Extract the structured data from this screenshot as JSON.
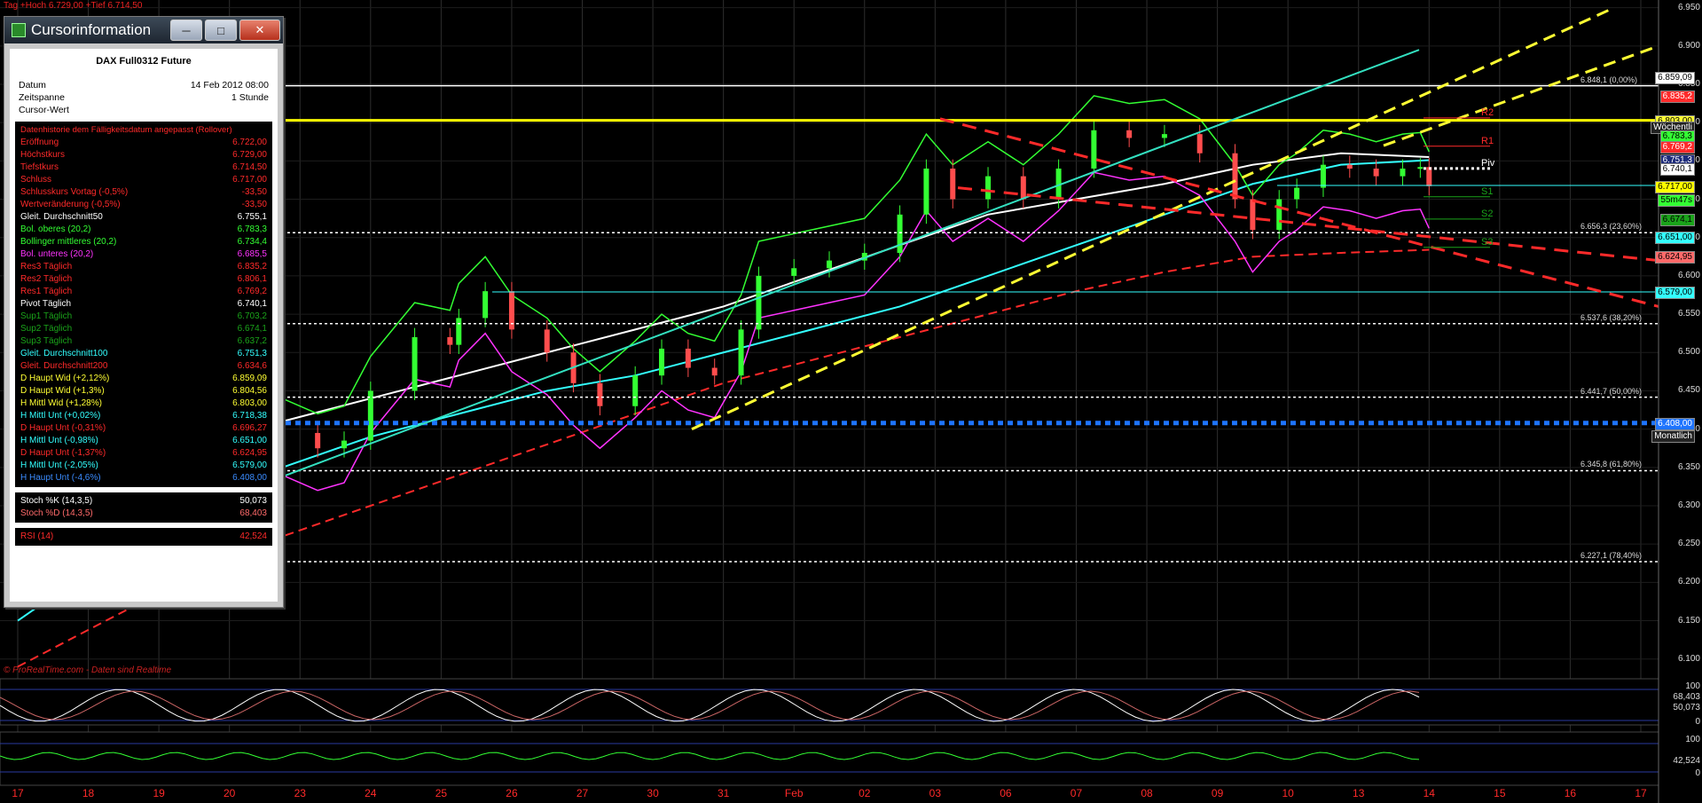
{
  "top_label": "Tag +Hoch 6.729,00 +Tief 6.714,50",
  "watermark": "© ProRealTime.com - Daten sind Realtime",
  "info_window": {
    "title": "Cursorinformation",
    "buttons": [
      "minimize",
      "maximize",
      "close"
    ],
    "instrument": "DAX Full0312 Future",
    "header_rows": [
      {
        "label": "Datum",
        "value": "14 Feb 2012 08:00"
      },
      {
        "label": "Zeitspanne",
        "value": "1 Stunde"
      },
      {
        "label": "Cursor-Wert",
        "value": ""
      }
    ],
    "history_title": "Datenhistorie dem Fälligkeitsdatum angepasst (Rollover)",
    "rows": [
      {
        "label": "Eröffnung",
        "value": "6.722,00",
        "color": "#ff2a2a"
      },
      {
        "label": "Höchstkurs",
        "value": "6.729,00",
        "color": "#ff2a2a"
      },
      {
        "label": "Tiefstkurs",
        "value": "6.714,50",
        "color": "#ff2a2a"
      },
      {
        "label": "Schluss",
        "value": "6.717,00",
        "color": "#ff2a2a"
      },
      {
        "label": "Schlusskurs Vortag (-0,5%)",
        "value": "-33,50",
        "color": "#ff2a2a"
      },
      {
        "label": "Wertveränderung (-0,5%)",
        "value": "-33,50",
        "color": "#ff2a2a"
      },
      {
        "label": "Gleit. Durchschnitt50",
        "value": "6.755,1",
        "color": "#ffffff"
      },
      {
        "label": "Bol. oberes (20,2)",
        "value": "6.783,3",
        "color": "#33ff33"
      },
      {
        "label": "Bollinger mittleres (20,2)",
        "value": "6.734,4",
        "color": "#33ff33"
      },
      {
        "label": "Bol. unteres (20,2)",
        "value": "6.685,5",
        "color": "#ff33ff"
      },
      {
        "label": "Res3 Täglich",
        "value": "6.835,2",
        "color": "#ff2a2a"
      },
      {
        "label": "Res2 Täglich",
        "value": "6.806,1",
        "color": "#ff2a2a"
      },
      {
        "label": "Res1 Täglich",
        "value": "6.769,2",
        "color": "#ff2a2a"
      },
      {
        "label": "Pivot Täglich",
        "value": "6.740,1",
        "color": "#ffffff"
      },
      {
        "label": "Sup1 Täglich",
        "value": "6.703,2",
        "color": "#1aa31a"
      },
      {
        "label": "Sup2 Täglich",
        "value": "6.674,1",
        "color": "#1aa31a"
      },
      {
        "label": "Sup3 Täglich",
        "value": "6.637,2",
        "color": "#1aa31a"
      },
      {
        "label": "Gleit. Durchschnitt100",
        "value": "6.751,3",
        "color": "#33ffff"
      },
      {
        "label": "Gleit. Durchschnitt200",
        "value": "6.634,6",
        "color": "#ff2a2a"
      },
      {
        "label": "D Haupt Wid (+2,12%)",
        "value": "6.859,09",
        "color": "#ffff33"
      },
      {
        "label": "D Haupt Wid (+1,3%)",
        "value": "6.804,56",
        "color": "#ffff33"
      },
      {
        "label": "H Mittl Wid (+1,28%)",
        "value": "6.803,00",
        "color": "#ffff33"
      },
      {
        "label": "H Mittl Unt (+0,02%)",
        "value": "6.718,38",
        "color": "#33ffff"
      },
      {
        "label": "D Haupt Unt (-0,31%)",
        "value": "6.696,27",
        "color": "#ff2a2a"
      },
      {
        "label": "H Mittl Unt (-0,98%)",
        "value": "6.651,00",
        "color": "#33ffff"
      },
      {
        "label": "D Haupt Unt (-1,37%)",
        "value": "6.624,95",
        "color": "#ff2a2a"
      },
      {
        "label": "H Mittl Unt (-2,05%)",
        "value": "6.579,00",
        "color": "#33ffff"
      },
      {
        "label": "H Haupt Unt (-4,6%)",
        "value": "6.408,00",
        "color": "#3b8cff"
      }
    ],
    "stoch_rows": [
      {
        "label": "Stoch %K (14,3,5)",
        "value": "50,073",
        "color": "#ffffff"
      },
      {
        "label": "Stoch %D (14,3,5)",
        "value": "68,403",
        "color": "#ff6a6a"
      }
    ],
    "rsi_row": {
      "label": "RSI (14)",
      "value": "42,524",
      "color": "#ff2a2a"
    }
  },
  "chart_data": {
    "type": "line",
    "instrument": "DAX Full0312 Future",
    "interval": "1 Stunde",
    "x_labels": [
      "17",
      "18",
      "19",
      "20",
      "23",
      "24",
      "25",
      "26",
      "27",
      "30",
      "31",
      "Feb",
      "02",
      "03",
      "06",
      "07",
      "08",
      "09",
      "10",
      "13",
      "14",
      "15",
      "16",
      "17"
    ],
    "y_ticks": [
      "6.950",
      "6.900",
      "6.850",
      "6.800",
      "6.750",
      "6.700",
      "6.650",
      "6.600",
      "6.550",
      "6.500",
      "6.450",
      "6.400",
      "6.350",
      "6.300",
      "6.250",
      "6.200",
      "6.150",
      "6.100"
    ],
    "ylim": [
      6080,
      6960
    ],
    "price": [
      {
        "t": 0,
        "v": 6390
      },
      {
        "t": 0.5,
        "v": 6405
      },
      {
        "t": 1,
        "v": 6420
      },
      {
        "t": 1.5,
        "v": 6400
      },
      {
        "t": 2,
        "v": 6380
      },
      {
        "t": 2.5,
        "v": 6360
      },
      {
        "t": 3,
        "v": 6395
      },
      {
        "t": 3.4,
        "v": 6375
      },
      {
        "t": 3.7,
        "v": 6385
      },
      {
        "t": 4,
        "v": 6450
      },
      {
        "t": 4.5,
        "v": 6520
      },
      {
        "t": 4.9,
        "v": 6510
      },
      {
        "t": 5,
        "v": 6545
      },
      {
        "t": 5.3,
        "v": 6580
      },
      {
        "t": 5.6,
        "v": 6530
      },
      {
        "t": 6,
        "v": 6500
      },
      {
        "t": 6.3,
        "v": 6460
      },
      {
        "t": 6.6,
        "v": 6430
      },
      {
        "t": 7,
        "v": 6470
      },
      {
        "t": 7.3,
        "v": 6505
      },
      {
        "t": 7.6,
        "v": 6480
      },
      {
        "t": 7.9,
        "v": 6470
      },
      {
        "t": 8.2,
        "v": 6530
      },
      {
        "t": 8.4,
        "v": 6600
      },
      {
        "t": 8.8,
        "v": 6610
      },
      {
        "t": 9.2,
        "v": 6620
      },
      {
        "t": 9.6,
        "v": 6630
      },
      {
        "t": 10,
        "v": 6680
      },
      {
        "t": 10.3,
        "v": 6740
      },
      {
        "t": 10.6,
        "v": 6700
      },
      {
        "t": 11,
        "v": 6730
      },
      {
        "t": 11.4,
        "v": 6700
      },
      {
        "t": 11.8,
        "v": 6740
      },
      {
        "t": 12.2,
        "v": 6790
      },
      {
        "t": 12.6,
        "v": 6780
      },
      {
        "t": 13,
        "v": 6785
      },
      {
        "t": 13.4,
        "v": 6760
      },
      {
        "t": 13.8,
        "v": 6700
      },
      {
        "t": 14,
        "v": 6660
      },
      {
        "t": 14.3,
        "v": 6700
      },
      {
        "t": 14.5,
        "v": 6715
      },
      {
        "t": 14.8,
        "v": 6745
      },
      {
        "t": 15.1,
        "v": 6740
      },
      {
        "t": 15.4,
        "v": 6730
      },
      {
        "t": 15.7,
        "v": 6740
      },
      {
        "t": 15.9,
        "v": 6742
      },
      {
        "t": 16.0,
        "v": 6717
      }
    ],
    "bands": [
      {
        "name": "Gleit. Durchschnitt50",
        "color": "#ffffff",
        "values": [
          6300,
          6330,
          6370,
          6410,
          6440,
          6470,
          6500,
          6530,
          6560,
          6600,
          6640,
          6680,
          6700,
          6720,
          6745,
          6760,
          6755
        ]
      },
      {
        "name": "Gleit. Durchschnitt100",
        "color": "#33ffff",
        "values": [
          6150,
          6230,
          6300,
          6350,
          6390,
          6420,
          6450,
          6470,
          6500,
          6530,
          6560,
          6600,
          6640,
          6680,
          6720,
          6745,
          6751
        ]
      },
      {
        "name": "Gleit. Durchschnitt200",
        "color": "#ff2a2a",
        "values": [
          6090,
          6150,
          6210,
          6260,
          6300,
          6340,
          6380,
          6420,
          6460,
          6490,
          6520,
          6550,
          6580,
          6605,
          6625,
          6630,
          6634
        ]
      }
    ],
    "horizontal_levels": [
      {
        "label": "6.848,1 (0,00%)",
        "value": 6848.1,
        "color": "#ffffff",
        "style": "solid"
      },
      {
        "label": "6.656,3 (23,60%)",
        "value": 6656.3,
        "color": "#ffffff",
        "style": "dotted"
      },
      {
        "label": "6.537,6 (38,20%)",
        "value": 6537.6,
        "color": "#ffffff",
        "style": "dotted"
      },
      {
        "label": "6.441,7 (50,00%)",
        "value": 6441.7,
        "color": "#ffffff",
        "style": "dotted"
      },
      {
        "label": "6.345,8 (61,80%)",
        "value": 6345.8,
        "color": "#ffffff",
        "style": "dotted"
      },
      {
        "label": "6.227,1 (78,40%)",
        "value": 6227.1,
        "color": "#ffffff",
        "style": "dotted"
      },
      {
        "label": "",
        "value": 6803,
        "color": "#ffff00",
        "style": "solid"
      },
      {
        "label": "",
        "value": 6408,
        "color": "#1e74ff",
        "style": "dotted"
      },
      {
        "label": "",
        "value": 6718,
        "color": "#33ffff",
        "style": "solid"
      },
      {
        "label": "",
        "value": 6579,
        "color": "#33ffff",
        "style": "solid"
      }
    ],
    "pivot_labels": [
      "R2",
      "R1",
      "Piv",
      "S1",
      "S2",
      "S3"
    ],
    "price_badges": [
      {
        "text": "6.859,09",
        "value": 6859.09,
        "bg": "#ffffff",
        "fg": "#000000"
      },
      {
        "text": "6.835,2",
        "value": 6835.2,
        "bg": "#ff2a2a",
        "fg": "#ffffff"
      },
      {
        "text": "6.803,00",
        "value": 6803,
        "bg": "#ffff33",
        "fg": "#000000"
      },
      {
        "text": "Wöchentli",
        "value": 6794,
        "bg": "#222222",
        "fg": "#ffffff"
      },
      {
        "text": "6.783,3",
        "value": 6783.3,
        "bg": "#33ff33",
        "fg": "#000000"
      },
      {
        "text": "6.769,2",
        "value": 6769.2,
        "bg": "#ff2a2a",
        "fg": "#ffffff"
      },
      {
        "text": "6.751,3",
        "value": 6751.3,
        "bg": "#1e2c7a",
        "fg": "#ffffff"
      },
      {
        "text": "6.740,1",
        "value": 6740.1,
        "bg": "#ffffff",
        "fg": "#000000"
      },
      {
        "text": "6.717,00",
        "value": 6717,
        "bg": "#ffff00",
        "fg": "#000000"
      },
      {
        "text": "55m47s",
        "value": 6700,
        "bg": "#33ff33",
        "fg": "#000000"
      },
      {
        "text": "6.674,1",
        "value": 6674.1,
        "bg": "#1aa31a",
        "fg": "#000000"
      },
      {
        "text": "6.651,00",
        "value": 6651,
        "bg": "#33ffff",
        "fg": "#000000"
      },
      {
        "text": "6.624,95",
        "value": 6624.95,
        "bg": "#ff6a6a",
        "fg": "#000000"
      },
      {
        "text": "6.579,00",
        "value": 6579,
        "bg": "#33ffff",
        "fg": "#000000"
      },
      {
        "text": "6.408,00",
        "value": 6408,
        "bg": "#1e74ff",
        "fg": "#ffffff"
      },
      {
        "text": "Monatlich",
        "value": 6392,
        "bg": "#222222",
        "fg": "#ffffff"
      }
    ],
    "stochastic": {
      "k": 50.073,
      "d": 68.403,
      "levels": [
        "100",
        "0"
      ],
      "badges": [
        "68,403",
        "50,073"
      ]
    },
    "rsi": {
      "value": 42.524,
      "levels": [
        "100",
        "0"
      ],
      "badge": "42,524"
    }
  }
}
